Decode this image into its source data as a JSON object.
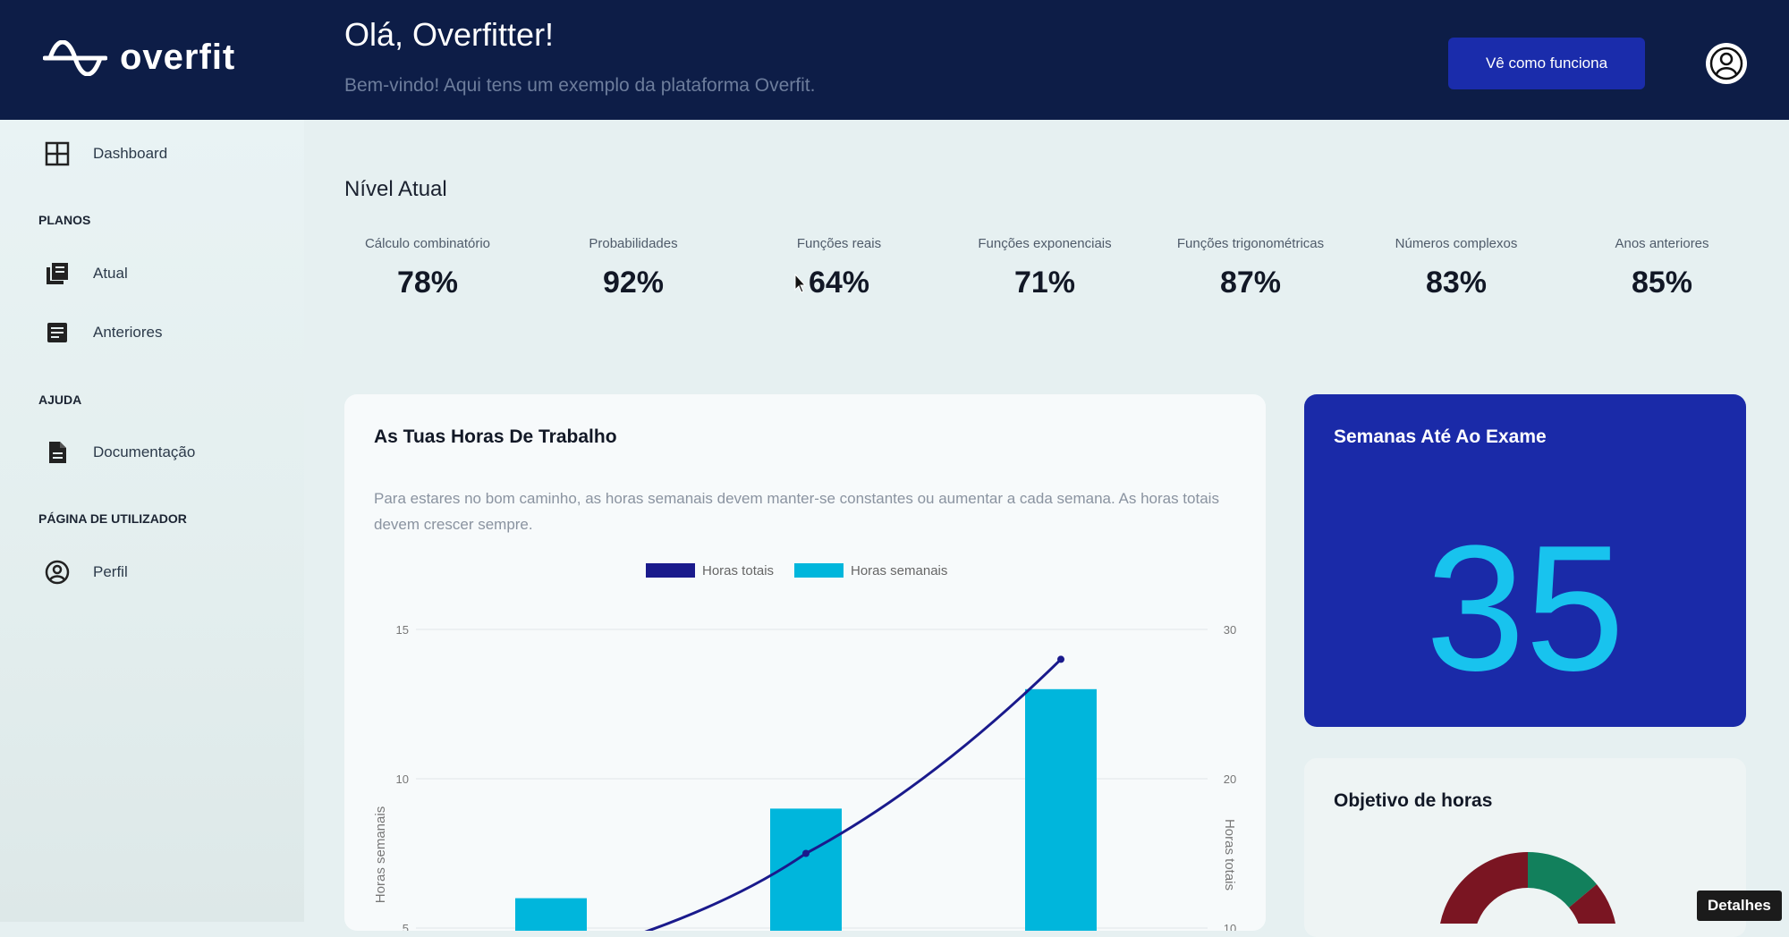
{
  "brand": {
    "name": "overfit"
  },
  "header": {
    "greeting": "Olá, Overfitter!",
    "subtitle": "Bem-vindo! Aqui tens um exemplo da plataforma Overfit.",
    "cta_label": "Vê como funciona"
  },
  "sidebar": {
    "dashboard": "Dashboard",
    "section_planos": "PLANOS",
    "atual": "Atual",
    "anteriores": "Anteriores",
    "section_ajuda": "AJUDA",
    "documentacao": "Documentação",
    "section_utilizador": "PÁGINA DE UTILIZADOR",
    "perfil": "Perfil"
  },
  "level": {
    "title": "Nível Atual",
    "stats": [
      {
        "label": "Cálculo combinatório",
        "value": "78%"
      },
      {
        "label": "Probabilidades",
        "value": "92%"
      },
      {
        "label": "Funções reais",
        "value": "64%"
      },
      {
        "label": "Funções exponenciais",
        "value": "71%"
      },
      {
        "label": "Funções trigonométricas",
        "value": "87%"
      },
      {
        "label": "Números complexos",
        "value": "83%"
      },
      {
        "label": "Anos anteriores",
        "value": "85%"
      }
    ]
  },
  "work_card": {
    "title": "As Tuas Horas De Trabalho",
    "description": "Para estares no bom caminho, as horas semanais devem manter-se constantes ou aumentar a cada semana. As horas totais devem crescer sempre."
  },
  "chart_data": {
    "type": "bar",
    "legend": [
      "Horas totais",
      "Horas semanais"
    ],
    "ylabel_left": "Horas semanais",
    "ylabel_right": "Horas totais",
    "left_ticks": [
      "15",
      "10",
      "5"
    ],
    "right_ticks": [
      "30",
      "20",
      "10"
    ],
    "ylim_left": [
      0,
      15
    ],
    "ylim_right": [
      0,
      30
    ],
    "series": [
      {
        "name": "Horas semanais",
        "type": "bar",
        "axis": "left",
        "values": [
          6,
          9,
          13
        ]
      },
      {
        "name": "Horas totais",
        "type": "line",
        "axis": "right",
        "values": [
          6,
          15,
          28
        ]
      }
    ],
    "colors": {
      "bar": "#00b6dc",
      "line": "#1a1a8c"
    }
  },
  "weeks_card": {
    "title": "Semanas Até Ao Exame",
    "value": "35"
  },
  "goal_card": {
    "title": "Objetivo de horas"
  },
  "overlay": {
    "details_label": "Detalhes"
  },
  "colors": {
    "header_bg": "#0d1d47",
    "accent_blue": "#1a2aa8",
    "cyan": "#18c3ee"
  }
}
